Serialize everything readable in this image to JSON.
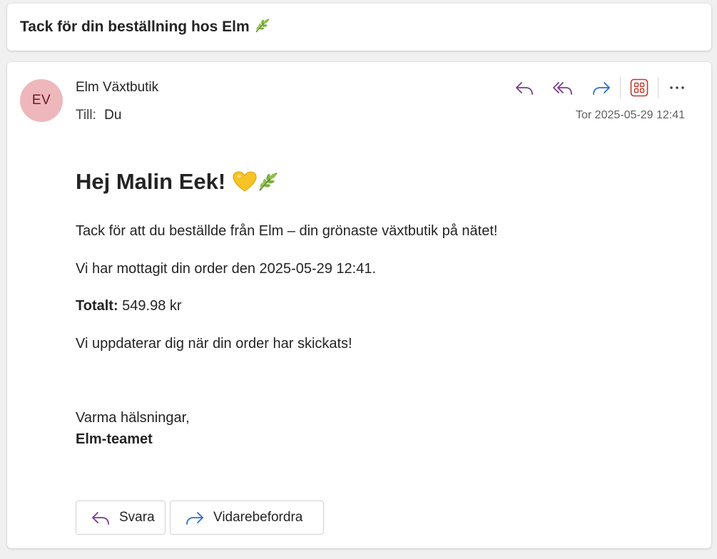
{
  "subject": {
    "text": "Tack för din beställning hos Elm",
    "emoji": "leaf"
  },
  "message": {
    "avatar_initials": "EV",
    "sender_name": "Elm Växtbutik",
    "to_label": "Till:",
    "to_value": "Du",
    "date": "Tor 2025-05-29 12:41",
    "toolbar": {
      "reply_icon": "reply-icon",
      "reply_all_icon": "reply-all-icon",
      "forward_icon": "forward-icon",
      "apps_icon": "apps-icon",
      "more_icon": "more-icon",
      "more_label": "···"
    },
    "body": {
      "greeting": "Hej Malin Eek!",
      "greeting_emojis": [
        "yellow-heart",
        "leaf"
      ],
      "line1": "Tack för att du beställde från Elm – din grönaste växtbutik på nätet!",
      "line2": "Vi har mottagit din order den 2025-05-29 12:41.",
      "total_label": "Totalt:",
      "total_value": "549.98 kr",
      "line4": "Vi uppdaterar dig när din order har skickats!",
      "closing": "Varma hälsningar,",
      "signature": "Elm-teamet"
    },
    "buttons": {
      "reply_label": "Svara",
      "forward_label": "Vidarebefordra"
    }
  },
  "colors": {
    "reply_purple": "#7b3a8f",
    "forward_blue": "#2f6fcc",
    "apps_red": "#c0392b",
    "avatar_bg": "#eeb7bc"
  }
}
